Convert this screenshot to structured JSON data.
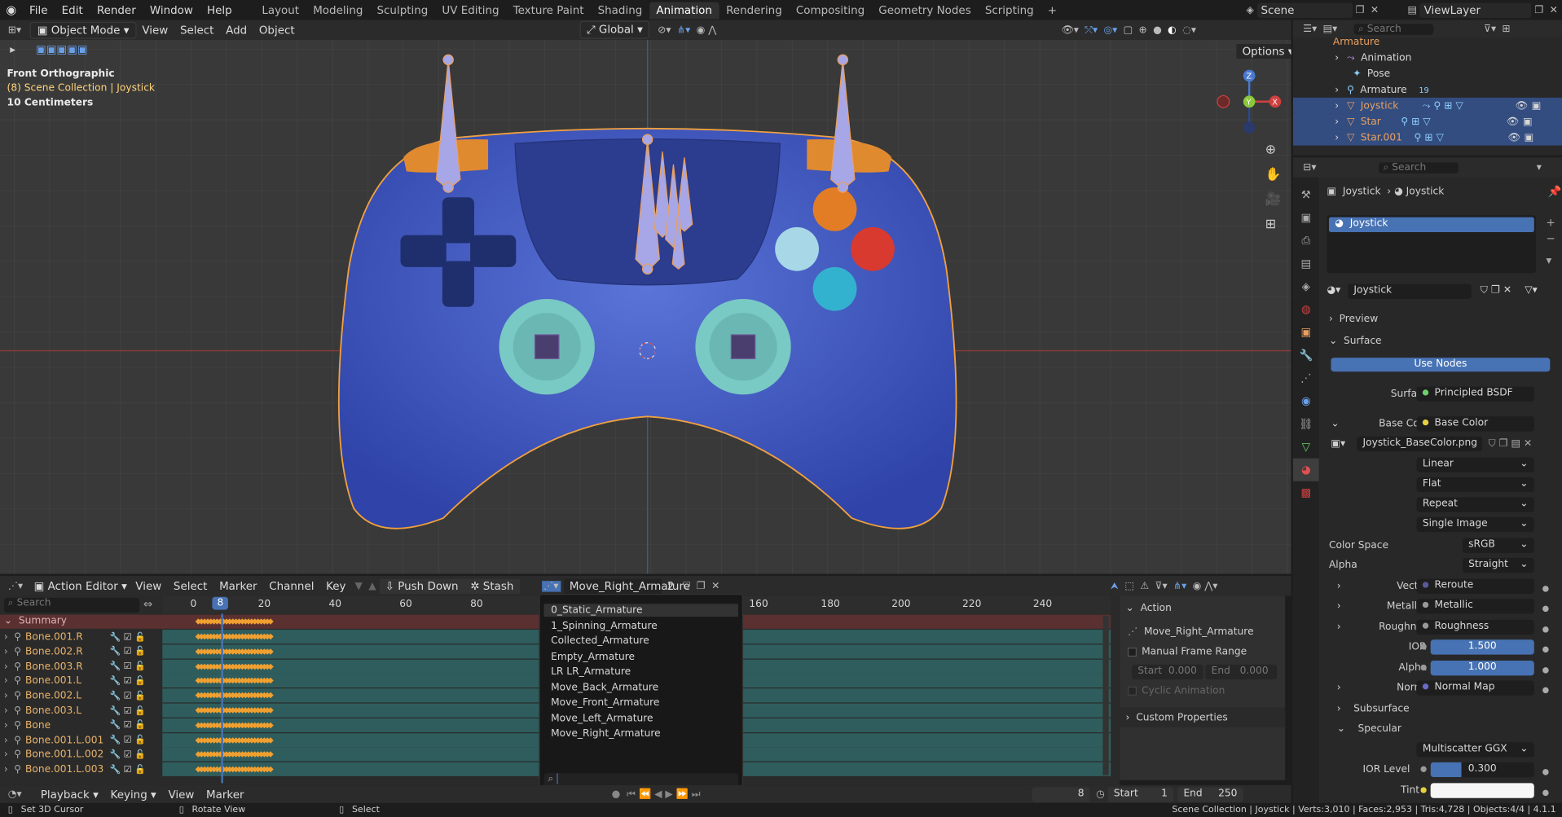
{
  "menu": [
    "File",
    "Edit",
    "Render",
    "Window",
    "Help"
  ],
  "workspaces": [
    "Layout",
    "Modeling",
    "Sculpting",
    "UV Editing",
    "Texture Paint",
    "Shading",
    "Animation",
    "Rendering",
    "Compositing",
    "Geometry Nodes",
    "Scripting"
  ],
  "active_workspace": "Animation",
  "scene": "Scene",
  "view_layer": "ViewLayer",
  "viewport": {
    "mode": "Object Mode",
    "menus": [
      "View",
      "Select",
      "Add",
      "Object"
    ],
    "transform": "Global",
    "options": "Options",
    "view_name": "Front Orthographic",
    "collection": "(8) Scene Collection",
    "object": "Joystick",
    "scale": "10 Centimeters",
    "gizmo": {
      "z": "Z",
      "y": "Y",
      "x": "X"
    }
  },
  "outliner": {
    "search_placeholder": "Search",
    "rows": [
      {
        "label": "Armature",
        "cls": "orange"
      },
      {
        "label": "Animation",
        "cls": "white"
      },
      {
        "label": "Pose",
        "cls": "white"
      },
      {
        "label": "Armature",
        "cls": "white",
        "badge": "19"
      },
      {
        "label": "Joystick",
        "cls": "orange"
      },
      {
        "label": "Star",
        "cls": "orange"
      },
      {
        "label": "Star.001",
        "cls": "orange"
      }
    ]
  },
  "properties": {
    "search_placeholder": "Search",
    "breadcrumb": [
      "Joystick",
      "Joystick"
    ],
    "material_slot": "Joystick",
    "material_name": "Joystick",
    "preview": "Preview",
    "surface": "Surface",
    "use_nodes": "Use Nodes",
    "rows": {
      "surface_label": "Surface",
      "surface_value": "Principled BSDF",
      "base_color_label": "Base Color",
      "base_color_value": "Base Color",
      "image": "Joystick_BaseColor.png",
      "interp": "Linear",
      "proj": "Flat",
      "ext": "Repeat",
      "source": "Single Image",
      "color_space_label": "Color Space",
      "color_space": "sRGB",
      "alpha_label": "Alpha",
      "alpha_mode": "Straight",
      "vector_label": "Vector",
      "vector": "Reroute",
      "metallic_label": "Metallic",
      "metallic": "Metallic",
      "roughness_label": "Roughness",
      "roughness": "Roughness",
      "ior_label": "IOR",
      "ior": "1.500",
      "alpha2_label": "Alpha",
      "alpha2": "1.000",
      "normal_label": "Normal",
      "normal": "Normal Map",
      "subsurface": "Subsurface",
      "specular": "Specular",
      "dist": "Multiscatter GGX",
      "ior_level_label": "IOR Level",
      "ior_level": "0.300",
      "tint_label": "Tint"
    }
  },
  "action_editor": {
    "editor": "Action Editor",
    "menus": [
      "View",
      "Select",
      "Marker",
      "Channel",
      "Key"
    ],
    "push_down": "Push Down",
    "stash": "Stash",
    "action": "Move_Right_Armature",
    "users": "2",
    "search_placeholder": "Search",
    "frames": [
      "0",
      "8",
      "20",
      "40",
      "60",
      "80",
      "160",
      "180",
      "200",
      "220",
      "240"
    ],
    "summary": "Summary",
    "tracks": [
      "Bone.001.R",
      "Bone.002.R",
      "Bone.003.R",
      "Bone.001.L",
      "Bone.002.L",
      "Bone.003.L",
      "Bone",
      "Bone.001.L.001",
      "Bone.001.L.002",
      "Bone.001.L.003"
    ],
    "actions_list": [
      "0_Static_Armature",
      "1_Spinning_Armature",
      "Collected_Armature",
      "Empty_Armature",
      "LR LR_Armature",
      "Move_Back_Armature",
      "Move_Front_Armature",
      "Move_Left_Armature",
      "Move_Right_Armature"
    ],
    "side": {
      "action_header": "Action",
      "action_name": "Move_Right_Armature",
      "manual_range": "Manual Frame Range",
      "start_label": "Start",
      "start": "0.000",
      "end_label": "End",
      "end": "0.000",
      "cyclic": "Cyclic Animation",
      "custom_props": "Custom Properties"
    }
  },
  "playback": {
    "menus": [
      "Playback",
      "Keying",
      "View",
      "Marker"
    ],
    "current_frame": "8",
    "start_label": "Start",
    "start": "1",
    "end_label": "End",
    "end": "250"
  },
  "status": {
    "hint1": "Set 3D Cursor",
    "hint2": "Rotate View",
    "hint3": "Select",
    "info": "Scene Collection | Joystick | Verts:3,010 | Faces:2,953 | Tris:4,728 | Objects:4/4 | 4.1.1"
  }
}
